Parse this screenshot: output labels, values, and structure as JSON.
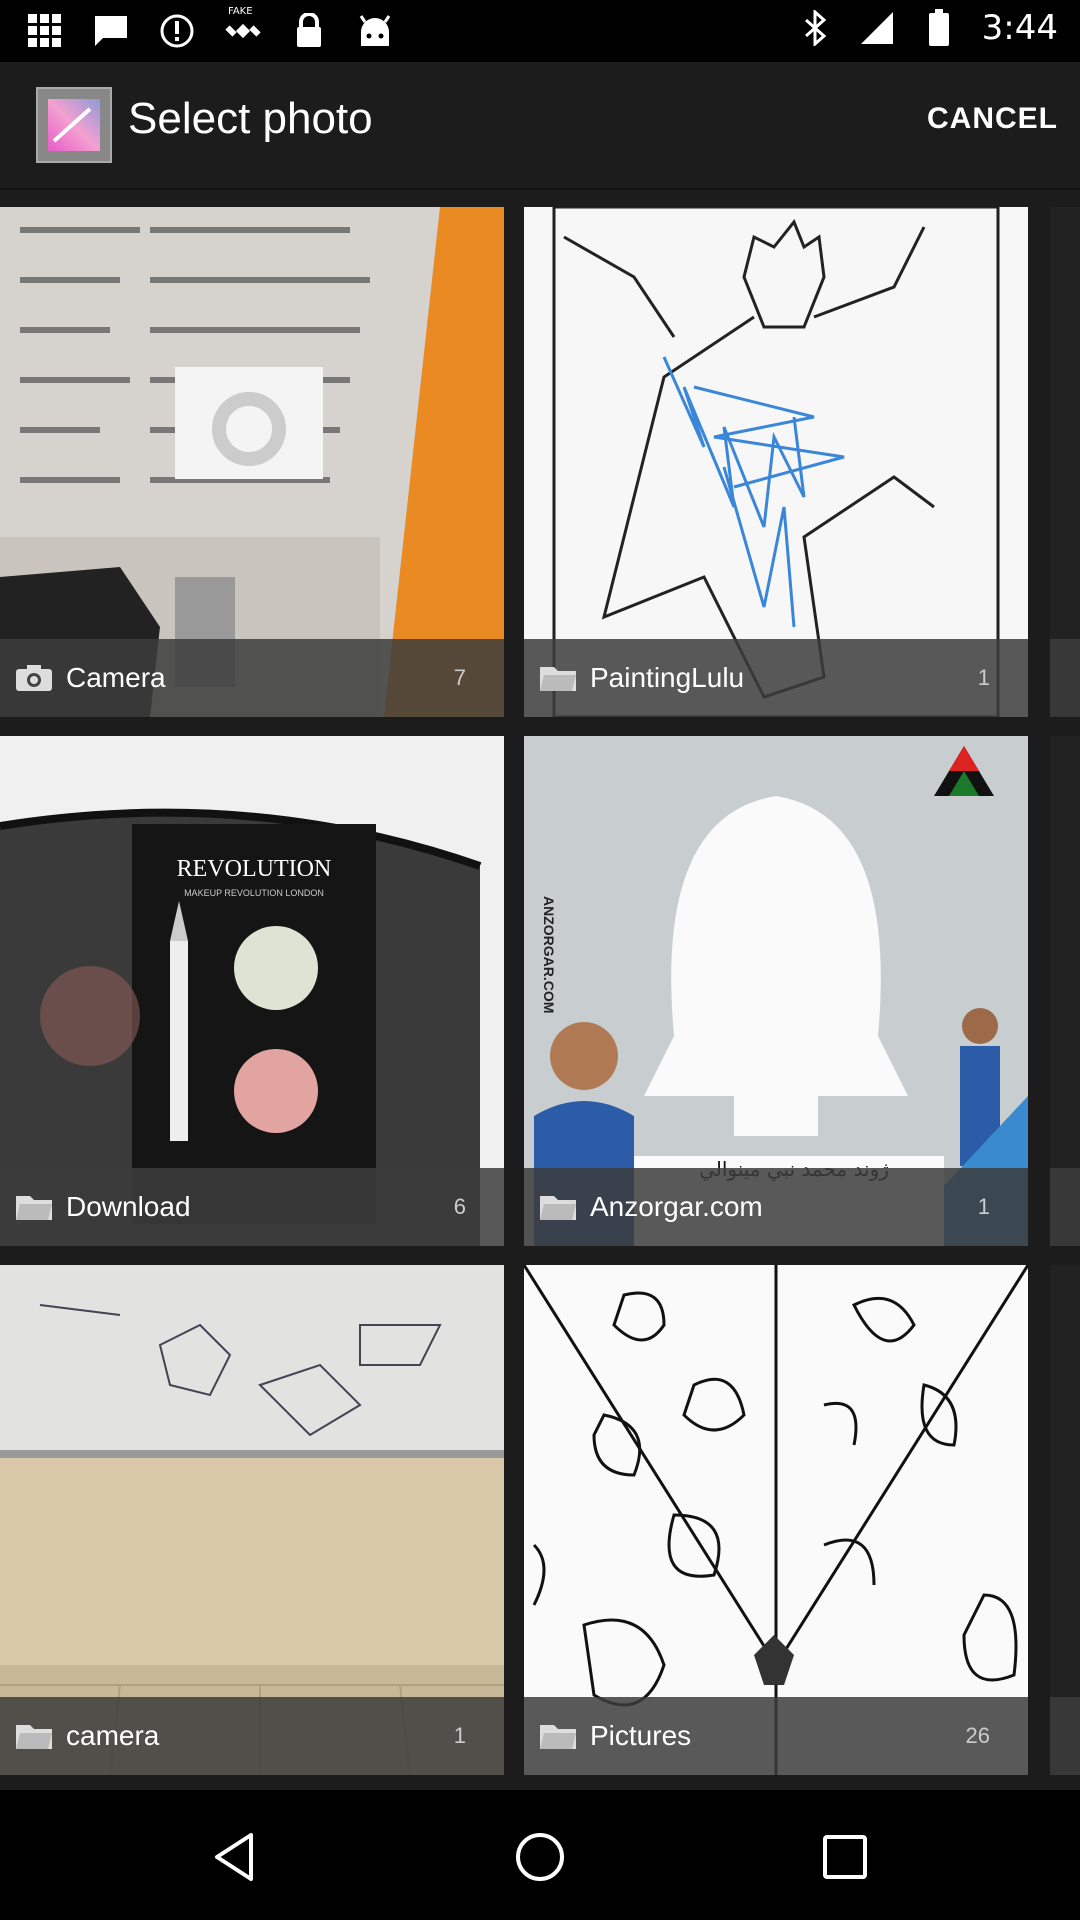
{
  "status_bar": {
    "time": "3:44",
    "left_icons": [
      "app-grid-icon",
      "message-icon",
      "alert-icon",
      "satellite-icon",
      "lock-icon",
      "android-icon"
    ],
    "satellite_badge": "FAKE",
    "right_icons": [
      "bluetooth-icon",
      "signal-icon",
      "battery-icon"
    ]
  },
  "app_bar": {
    "title": "Select photo",
    "cancel_label": "CANCEL"
  },
  "albums": [
    {
      "name": "Camera",
      "count": "7",
      "icon": "camera-icon"
    },
    {
      "name": "PaintingLulu",
      "count": "1",
      "icon": "folder-icon"
    },
    {
      "name": "Download",
      "count": "6",
      "icon": "folder-icon"
    },
    {
      "name": "Anzorgar.com",
      "count": "1",
      "icon": "folder-icon"
    },
    {
      "name": "camera",
      "count": "1",
      "icon": "folder-icon"
    },
    {
      "name": "Pictures",
      "count": "26",
      "icon": "folder-icon"
    }
  ],
  "thumb_text": {
    "revolution_brand": "REVOLUTION",
    "revolution_sub": "MAKEUP REVOLUTION LONDON",
    "anzorgar_side": "ANZORGAR.COM",
    "anzorgar_bottom": "ژوند محمد نبي مينوالي"
  },
  "nav_bar": {
    "icons": [
      "back-icon",
      "home-icon",
      "recents-icon"
    ]
  },
  "colors": {
    "background": "#1c1c1c",
    "status_bar": "#000000",
    "label_overlay": "#3c3c3c"
  }
}
